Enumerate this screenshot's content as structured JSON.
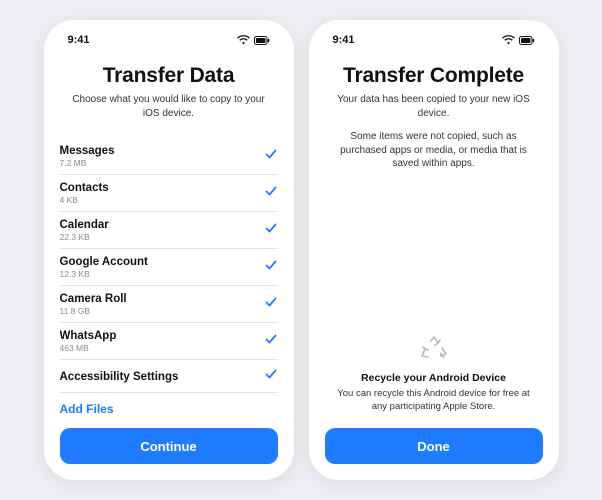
{
  "status": {
    "time": "9:41"
  },
  "screen1": {
    "title": "Transfer Data",
    "subtitle": "Choose what you would like to copy to your iOS device.",
    "items": [
      {
        "label": "Messages",
        "size": "7.2 MB"
      },
      {
        "label": "Contacts",
        "size": "4 KB"
      },
      {
        "label": "Calendar",
        "size": "22.3 KB"
      },
      {
        "label": "Google Account",
        "size": "12.3 KB"
      },
      {
        "label": "Camera Roll",
        "size": "11.8 GB"
      },
      {
        "label": "WhatsApp",
        "size": "463 MB"
      },
      {
        "label": "Accessibility Settings",
        "size": ""
      }
    ],
    "add_files": "Add Files",
    "continue": "Continue"
  },
  "screen2": {
    "title": "Transfer Complete",
    "subtitle": "Your data has been copied to your new iOS device.",
    "note": "Some items were not copied, such as purchased apps or media, or media that is saved within apps.",
    "recycle_title": "Recycle your Android Device",
    "recycle_text": "You can recycle this Android device for free at any participating Apple Store.",
    "done": "Done"
  }
}
